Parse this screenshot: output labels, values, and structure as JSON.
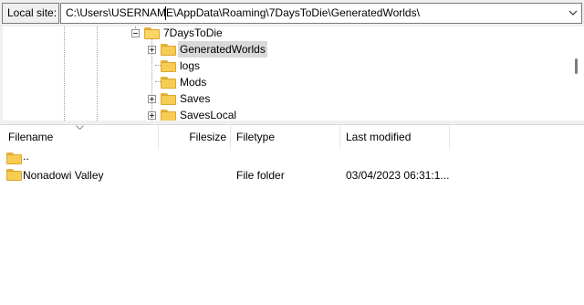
{
  "site_bar": {
    "label": "Local site:",
    "path": "C:\\Users\\USERNAME\\AppData\\Roaming\\7DaysToDie\\GeneratedWorlds\\"
  },
  "tree": {
    "items": [
      {
        "label": "7DaysToDie",
        "expander": "minus",
        "open": true
      },
      {
        "label": "GeneratedWorlds",
        "expander": "plus",
        "selected": true
      },
      {
        "label": "logs"
      },
      {
        "label": "Mods"
      },
      {
        "label": "Saves",
        "expander": "plus"
      },
      {
        "label": "SavesLocal",
        "expander": "plus"
      }
    ]
  },
  "file_list": {
    "columns": [
      "Filename",
      "Filesize",
      "Filetype",
      "Last modified"
    ],
    "rows": [
      {
        "name": "..",
        "size": "",
        "type": "",
        "modified": ""
      },
      {
        "name": "Nonadowi Valley",
        "size": "",
        "type": "File folder",
        "modified": "03/04/2023 06:31:1..."
      }
    ]
  },
  "icons": {
    "folder": "folder-icon",
    "combo": "chevron-down-icon",
    "sort": "sort-chevron-icon"
  },
  "colors": {
    "folder_fill": "#f7cc52",
    "selection": "#d9d9d9"
  }
}
